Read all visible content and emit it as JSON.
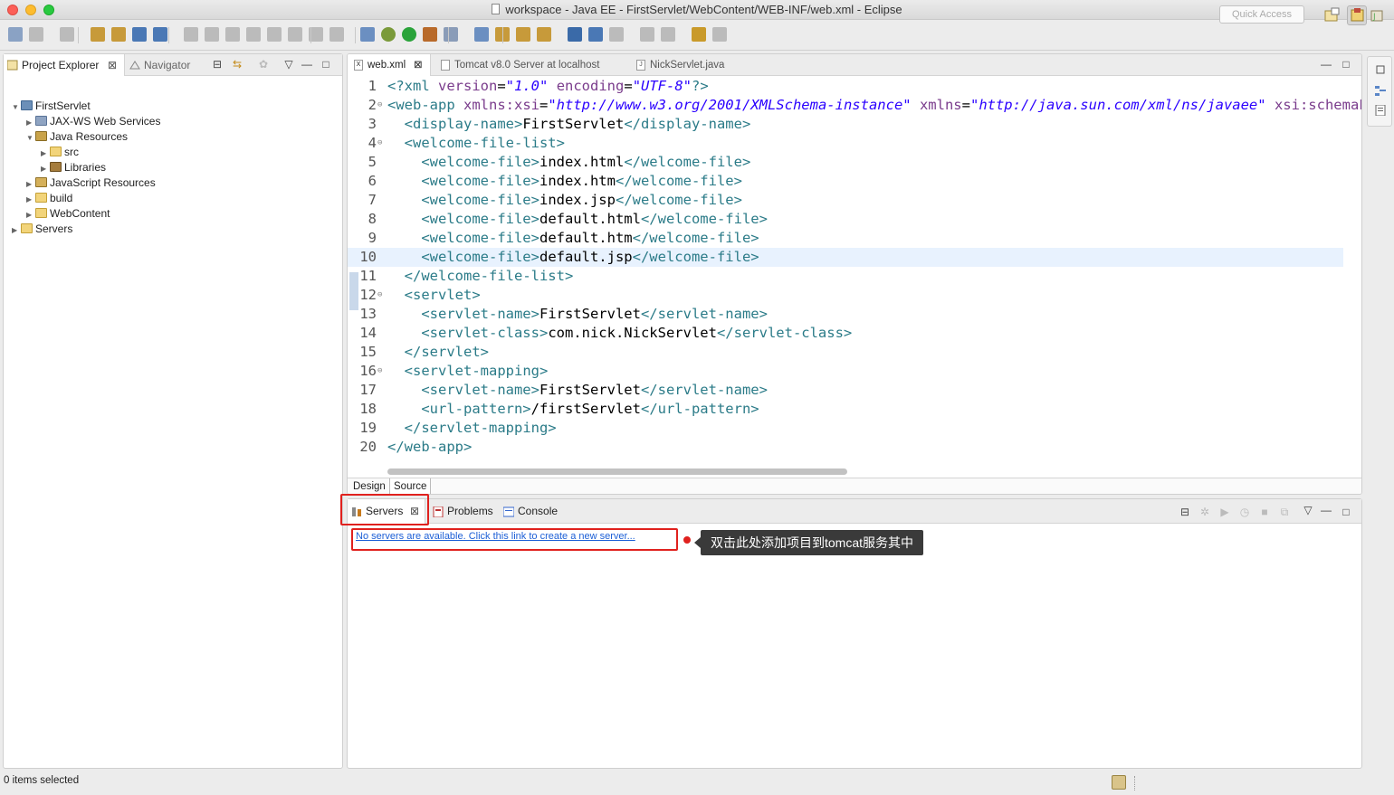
{
  "window": {
    "title": "workspace - Java EE - FirstServlet/WebContent/WEB-INF/web.xml - Eclipse"
  },
  "toolbar": {
    "quick_access_placeholder": "Quick Access",
    "icons": [
      "new-icon",
      "save-icon",
      "save-all-icon",
      "servers-icon",
      "build-icon",
      "terminal-icon",
      "pin-icon",
      "resume-icon",
      "suspend-icon",
      "terminate-icon",
      "disconnect-icon",
      "step-into-icon",
      "step-over-icon",
      "step-return-icon",
      "drop-to-frame-icon",
      "use-step-filters-icon",
      "debug-icon",
      "run-icon",
      "run-server-icon",
      "new-server-icon",
      "new-class-icon",
      "open-type-icon",
      "open-task-icon",
      "search-icon",
      "globe-icon",
      "refresh-icon",
      "next-annotation-icon",
      "prev-annotation-icon",
      "last-edit-icon",
      "back-icon",
      "forward-icon"
    ]
  },
  "explorer": {
    "tabs": [
      {
        "label": "Project Explorer",
        "active": true
      },
      {
        "label": "Navigator",
        "active": false
      }
    ],
    "tree": [
      {
        "label": "FirstServlet",
        "depth": 0,
        "expanded": true,
        "icon": "project-icon"
      },
      {
        "label": "JAX-WS Web Services",
        "depth": 1,
        "expanded": false,
        "icon": "web-services-icon"
      },
      {
        "label": "Java Resources",
        "depth": 1,
        "expanded": true,
        "icon": "java-resources-icon"
      },
      {
        "label": "src",
        "depth": 2,
        "expanded": false,
        "icon": "package-folder-icon"
      },
      {
        "label": "Libraries",
        "depth": 2,
        "expanded": false,
        "icon": "libraries-icon"
      },
      {
        "label": "JavaScript Resources",
        "depth": 1,
        "expanded": false,
        "icon": "javascript-resources-icon"
      },
      {
        "label": "build",
        "depth": 1,
        "expanded": false,
        "icon": "folder-icon"
      },
      {
        "label": "WebContent",
        "depth": 1,
        "expanded": false,
        "icon": "folder-icon"
      },
      {
        "label": "Servers",
        "depth": 0,
        "expanded": false,
        "icon": "folder-icon"
      }
    ]
  },
  "editor": {
    "tabs": [
      {
        "label": "web.xml",
        "active": true,
        "closable": true
      },
      {
        "label": "Tomcat v8.0 Server at localhost",
        "active": false
      },
      {
        "label": "NickServlet.java",
        "active": false
      }
    ],
    "highlighted_line": 10,
    "lines": [
      {
        "n": "1",
        "fold": "",
        "parts": [
          [
            "tag",
            "<?xml "
          ],
          [
            "attr",
            "version"
          ],
          [
            "plain",
            "="
          ],
          [
            "val",
            "\"1.0\""
          ],
          [
            "plain",
            " "
          ],
          [
            "attr",
            "encoding"
          ],
          [
            "plain",
            "="
          ],
          [
            "val",
            "\"UTF-8\""
          ],
          [
            "tag",
            "?>"
          ]
        ]
      },
      {
        "n": "2",
        "fold": "⊖",
        "parts": [
          [
            "tag",
            "<web-app "
          ],
          [
            "attr",
            "xmlns:xsi"
          ],
          [
            "plain",
            "="
          ],
          [
            "val",
            "\"http://www.w3.org/2001/XMLSchema-instance\""
          ],
          [
            "plain",
            " "
          ],
          [
            "attr",
            "xmlns"
          ],
          [
            "plain",
            "="
          ],
          [
            "val",
            "\"http://java.sun.com/xml/ns/javaee\""
          ],
          [
            "plain",
            " "
          ],
          [
            "attr",
            "xsi:schemaLo"
          ]
        ]
      },
      {
        "n": "3",
        "fold": "",
        "parts": [
          [
            "plain",
            "  "
          ],
          [
            "tag",
            "<display-name>"
          ],
          [
            "plain",
            "FirstServlet"
          ],
          [
            "tag",
            "</display-name>"
          ]
        ]
      },
      {
        "n": "4",
        "fold": "⊖",
        "parts": [
          [
            "plain",
            "  "
          ],
          [
            "tag",
            "<welcome-file-list>"
          ]
        ]
      },
      {
        "n": "5",
        "fold": "",
        "parts": [
          [
            "plain",
            "    "
          ],
          [
            "tag",
            "<welcome-file>"
          ],
          [
            "plain",
            "index.html"
          ],
          [
            "tag",
            "</welcome-file>"
          ]
        ]
      },
      {
        "n": "6",
        "fold": "",
        "parts": [
          [
            "plain",
            "    "
          ],
          [
            "tag",
            "<welcome-file>"
          ],
          [
            "plain",
            "index.htm"
          ],
          [
            "tag",
            "</welcome-file>"
          ]
        ]
      },
      {
        "n": "7",
        "fold": "",
        "parts": [
          [
            "plain",
            "    "
          ],
          [
            "tag",
            "<welcome-file>"
          ],
          [
            "plain",
            "index.jsp"
          ],
          [
            "tag",
            "</welcome-file>"
          ]
        ]
      },
      {
        "n": "8",
        "fold": "",
        "parts": [
          [
            "plain",
            "    "
          ],
          [
            "tag",
            "<welcome-file>"
          ],
          [
            "plain",
            "default.html"
          ],
          [
            "tag",
            "</welcome-file>"
          ]
        ]
      },
      {
        "n": "9",
        "fold": "",
        "parts": [
          [
            "plain",
            "    "
          ],
          [
            "tag",
            "<welcome-file>"
          ],
          [
            "plain",
            "default.htm"
          ],
          [
            "tag",
            "</welcome-file>"
          ]
        ]
      },
      {
        "n": "10",
        "fold": "",
        "parts": [
          [
            "plain",
            "    "
          ],
          [
            "tag",
            "<welcome-file>"
          ],
          [
            "plain",
            "default.jsp"
          ],
          [
            "tag",
            "</welcome-file>"
          ]
        ]
      },
      {
        "n": "11",
        "fold": "",
        "parts": [
          [
            "plain",
            "  "
          ],
          [
            "tag",
            "</welcome-file-list>"
          ]
        ]
      },
      {
        "n": "12",
        "fold": "⊖",
        "parts": [
          [
            "plain",
            "  "
          ],
          [
            "tag",
            "<servlet>"
          ]
        ]
      },
      {
        "n": "13",
        "fold": "",
        "parts": [
          [
            "plain",
            "    "
          ],
          [
            "tag",
            "<servlet-name>"
          ],
          [
            "plain",
            "FirstServlet"
          ],
          [
            "tag",
            "</servlet-name>"
          ]
        ]
      },
      {
        "n": "14",
        "fold": "",
        "parts": [
          [
            "plain",
            "    "
          ],
          [
            "tag",
            "<servlet-class>"
          ],
          [
            "plain",
            "com.nick.NickServlet"
          ],
          [
            "tag",
            "</servlet-class>"
          ]
        ]
      },
      {
        "n": "15",
        "fold": "",
        "parts": [
          [
            "plain",
            "  "
          ],
          [
            "tag",
            "</servlet>"
          ]
        ]
      },
      {
        "n": "16",
        "fold": "⊖",
        "parts": [
          [
            "plain",
            "  "
          ],
          [
            "tag",
            "<servlet-mapping>"
          ]
        ]
      },
      {
        "n": "17",
        "fold": "",
        "parts": [
          [
            "plain",
            "    "
          ],
          [
            "tag",
            "<servlet-name>"
          ],
          [
            "plain",
            "FirstServlet"
          ],
          [
            "tag",
            "</servlet-name>"
          ]
        ]
      },
      {
        "n": "18",
        "fold": "",
        "parts": [
          [
            "plain",
            "    "
          ],
          [
            "tag",
            "<url-pattern>"
          ],
          [
            "plain",
            "/firstServlet"
          ],
          [
            "tag",
            "</url-pattern>"
          ]
        ]
      },
      {
        "n": "19",
        "fold": "",
        "parts": [
          [
            "plain",
            "  "
          ],
          [
            "tag",
            "</servlet-mapping>"
          ]
        ]
      },
      {
        "n": "20",
        "fold": "",
        "parts": [
          [
            "tag",
            "</web-app>"
          ]
        ]
      }
    ],
    "bottom_tabs": [
      {
        "label": "Design",
        "active": false
      },
      {
        "label": "Source",
        "active": true
      }
    ]
  },
  "bottom_panel": {
    "tabs": [
      {
        "label": "Servers",
        "active": true,
        "closable": true
      },
      {
        "label": "Problems",
        "active": false
      },
      {
        "label": "Console",
        "active": false
      }
    ],
    "servers_link": "No servers are available. Click this link to create a new server...",
    "annotation_tooltip": "双击此处添加项目到tomcat服务其中",
    "annotation_color": "#e0211e"
  },
  "status": {
    "text": "0 items selected"
  }
}
